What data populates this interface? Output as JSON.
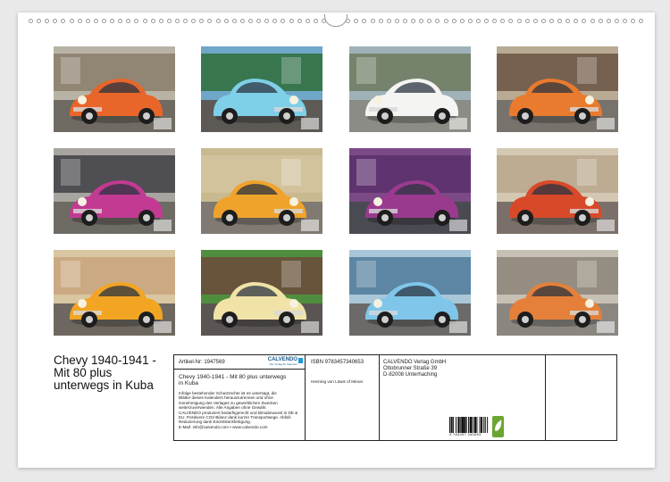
{
  "title": {
    "line1": "Chevy 1940-1941 -",
    "line2": "Mit 80 plus",
    "line3": "unterwegs in Kuba"
  },
  "info": {
    "article_nr": "Artikel-Nr: 1947569",
    "logo_text": "CALVENDO",
    "logo_sub": "Der Verlag für Kalender",
    "calendar_title_1": "Chevy 1940-1941 - Mit 80 plus unterwegs",
    "calendar_title_2": "in Kuba",
    "legal": [
      "Infolge bestehender Schutzrechte ist es untersagt, die",
      "Blätter dieses Kalenders herauszutrennen und ohne",
      "Genehmigung des Verlages zu gewerblichen Zwecken",
      "weiterzuverwenden. Alle Angaben ohne Gewähr.",
      "CALVENDO produziert bedarfsgerecht und klimabewusst in DE &",
      "EU. Positivere CO2-Bilanz dank kurzer Transportwege. Abfall-",
      "Reduzierung dank Einzelstückfertigung.",
      "E-Mail: info@calvendo.com • www.calvendo.com"
    ],
    "isbn": "ISBN 9783457340653",
    "author": "Henning von Löwis of Menar",
    "publisher_1": "CALVENDO Verlag GmbH",
    "publisher_2": "Ottobrunner Straße 39",
    "publisher_3": "D-82008 Unterhaching",
    "barcode_digits": "9 783457 340653"
  },
  "thumbnails": [
    {
      "name": "thumb-jan",
      "car": "#e8662a",
      "bg": "#8a7c6a",
      "ground": "#6f6a62",
      "sky": "#b9b3a6"
    },
    {
      "name": "thumb-feb",
      "car": "#7fcfe8",
      "bg": "#2f6d3a",
      "ground": "#5d5a56",
      "sky": "#6fa7c9"
    },
    {
      "name": "thumb-mar",
      "car": "#f4f4f2",
      "bg": "#6d7a5e",
      "ground": "#8c8c86",
      "sky": "#9fb2b9"
    },
    {
      "name": "thumb-apr",
      "car": "#e97b2e",
      "bg": "#6a5544",
      "ground": "#77726c",
      "sky": "#b8aa93"
    },
    {
      "name": "thumb-may",
      "car": "#c23a92",
      "bg": "#3f3f44",
      "ground": "#6e6a64",
      "sky": "#a8a4a0"
    },
    {
      "name": "thumb-jun",
      "car": "#f0a32b",
      "bg": "#d4c4a0",
      "ground": "#807a72",
      "sky": "#c9b98f"
    },
    {
      "name": "thumb-jul",
      "car": "#9a3a8e",
      "bg": "#5a2f6c",
      "ground": "#4a4a52",
      "sky": "#7b4a86"
    },
    {
      "name": "thumb-aug",
      "car": "#d8492a",
      "bg": "#b9a78c",
      "ground": "#7b7069",
      "sky": "#d4c8b3"
    },
    {
      "name": "thumb-sep",
      "car": "#f2a523",
      "bg": "#c8a47e",
      "ground": "#6d675f",
      "sky": "#d9c6a2"
    },
    {
      "name": "thumb-oct",
      "car": "#f1e2a8",
      "bg": "#6b4a3a",
      "ground": "#5a5552",
      "sky": "#4f8e3e"
    },
    {
      "name": "thumb-nov",
      "car": "#7fc6ea",
      "bg": "#4f7a9a",
      "ground": "#6c6a68",
      "sky": "#a9c7d8"
    },
    {
      "name": "thumb-dec",
      "car": "#e4803a",
      "bg": "#8c8478",
      "ground": "#8b8680",
      "sky": "#c7c0b4"
    }
  ]
}
